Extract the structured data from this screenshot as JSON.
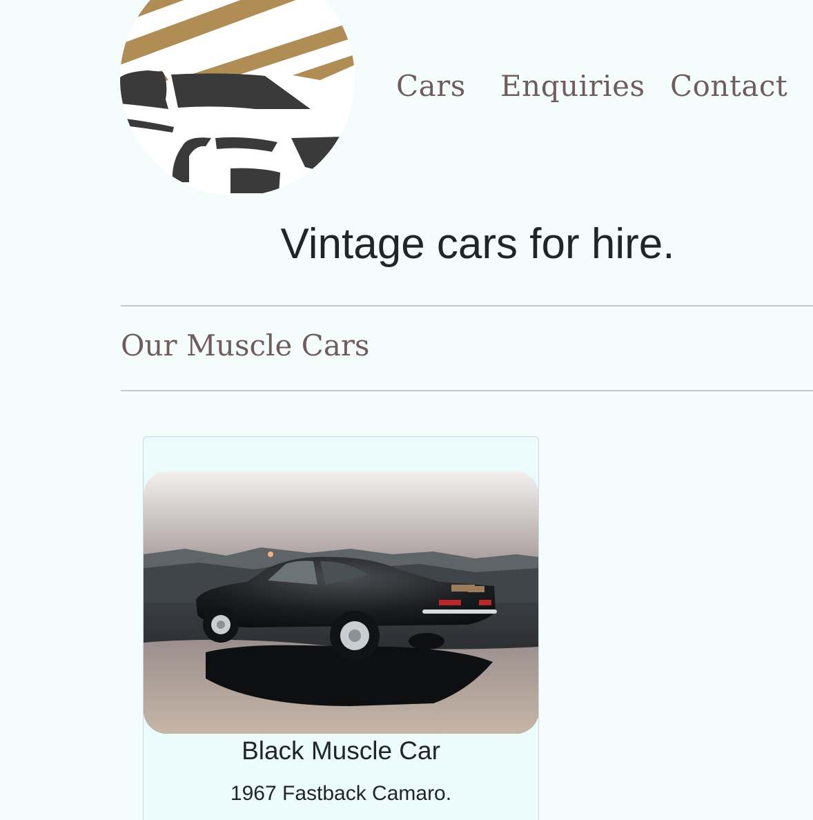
{
  "header": {
    "logo_icon": "car-logo-icon",
    "nav": [
      {
        "label": "Cars"
      },
      {
        "label": "Enquiries"
      },
      {
        "label": "Contact"
      }
    ]
  },
  "hero": {
    "title": "Vintage cars for hire."
  },
  "section": {
    "title": "Our Muscle Cars"
  },
  "cards": [
    {
      "image_alt": "black-muscle-car-photo",
      "title": "Black Muscle Car",
      "text": "1967 Fastback Camaro."
    }
  ],
  "colors": {
    "background": "#f4fcfc",
    "nav_text": "#6f5d5c",
    "heading": "#212529",
    "logo_gold": "#b08d55",
    "logo_dark": "#3a3a3a",
    "card_bg": "#ebfafb"
  }
}
